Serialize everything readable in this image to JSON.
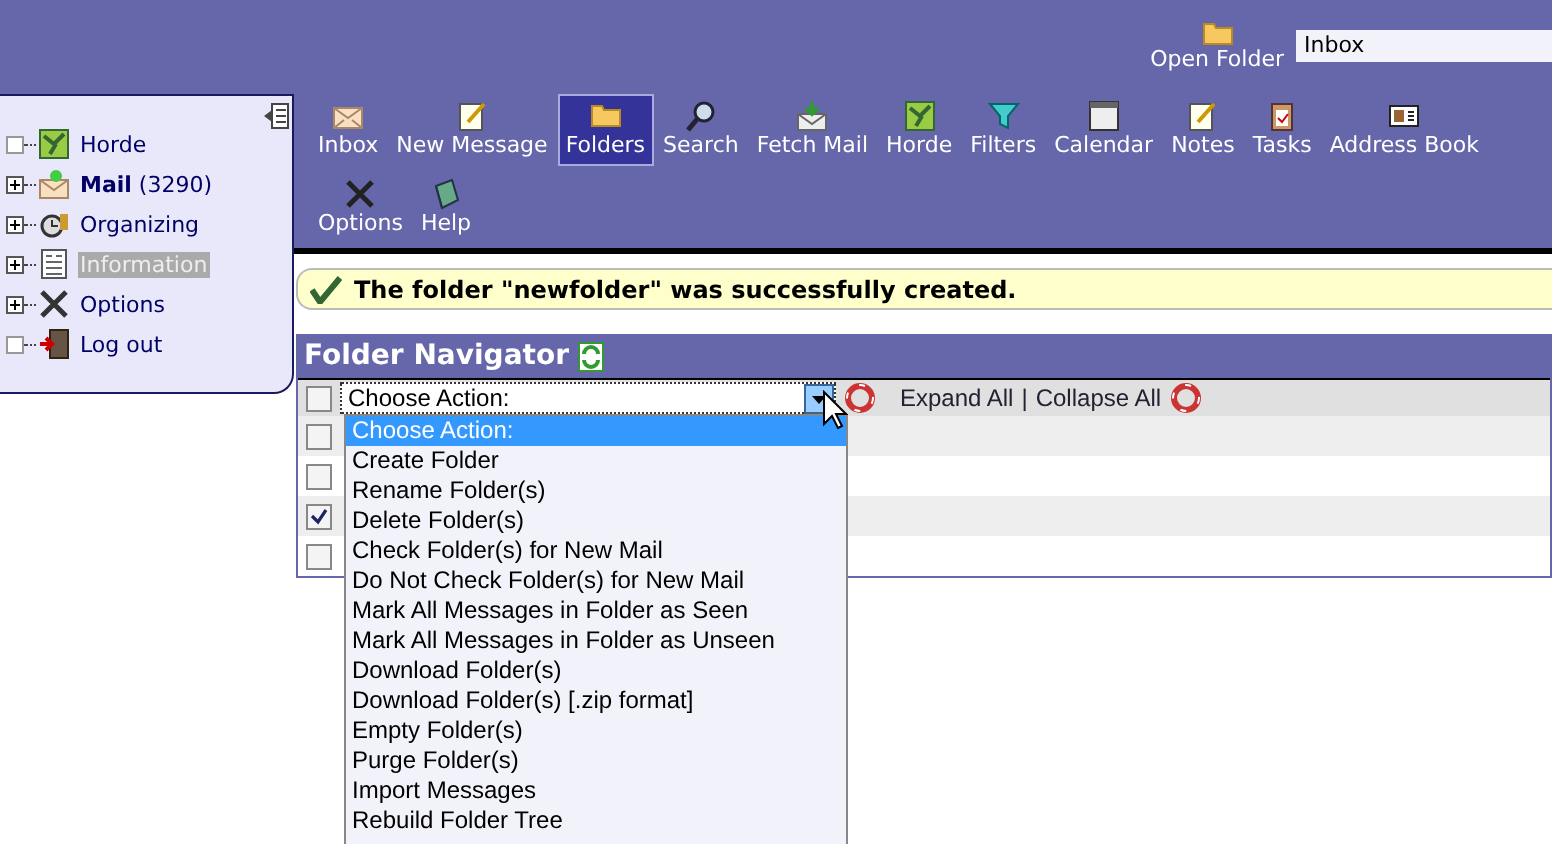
{
  "header": {
    "open_folder_label": "Open Folder",
    "folder_field": "Inbox"
  },
  "sidebar": {
    "items": [
      {
        "label": "Horde",
        "expandable": false,
        "selected": false
      },
      {
        "label": "**Mail** (3290)",
        "expandable": true,
        "selected": false
      },
      {
        "label": "Organizing",
        "expandable": true,
        "selected": false
      },
      {
        "label": "Information",
        "expandable": true,
        "selected": true
      },
      {
        "label": "Options",
        "expandable": true,
        "selected": false
      },
      {
        "label": "Log out",
        "expandable": false,
        "selected": false
      }
    ]
  },
  "toolbar": [
    {
      "label": "Inbox",
      "selected": false
    },
    {
      "label": "New Message",
      "selected": false
    },
    {
      "label": "Folders",
      "selected": true
    },
    {
      "label": "Search",
      "selected": false
    },
    {
      "label": "Fetch Mail",
      "selected": false
    },
    {
      "label": "Horde",
      "selected": false
    },
    {
      "label": "Filters",
      "selected": false
    },
    {
      "label": "Calendar",
      "selected": false
    },
    {
      "label": "Notes",
      "selected": false
    },
    {
      "label": "Tasks",
      "selected": false
    },
    {
      "label": "Address Book",
      "selected": false
    },
    {
      "label": "Options",
      "selected": false
    },
    {
      "label": "Help",
      "selected": false
    }
  ],
  "message": "The folder \"newfolder\" was successfully created.",
  "navigator": {
    "title": "Folder Navigator",
    "action_select": "Choose Action:",
    "header_checked": false,
    "links": [
      "Expand All",
      "Collapse All"
    ],
    "link_separator": "|",
    "rows": [
      {
        "checked": false
      },
      {
        "checked": false
      },
      {
        "checked": true
      },
      {
        "checked": false
      }
    ]
  },
  "dropdown": {
    "options": [
      {
        "label": "Choose Action:",
        "selected": true
      },
      {
        "label": "Create Folder",
        "selected": false
      },
      {
        "label": "Rename Folder(s)",
        "selected": false
      },
      {
        "label": "Delete Folder(s)",
        "selected": false
      },
      {
        "label": "Check Folder(s) for New Mail",
        "selected": false
      },
      {
        "label": "Do Not Check Folder(s) for New Mail",
        "selected": false
      },
      {
        "label": "Mark All Messages in Folder as Seen",
        "selected": false
      },
      {
        "label": "Mark All Messages in Folder as Unseen",
        "selected": false
      },
      {
        "label": "Download Folder(s)",
        "selected": false
      },
      {
        "label": "Download Folder(s) [.zip format]",
        "selected": false
      },
      {
        "label": "Empty Folder(s)",
        "selected": false
      },
      {
        "label": "Purge Folder(s)",
        "selected": false
      },
      {
        "label": "Import Messages",
        "selected": false
      },
      {
        "label": "Rebuild Folder Tree",
        "selected": false
      }
    ]
  }
}
